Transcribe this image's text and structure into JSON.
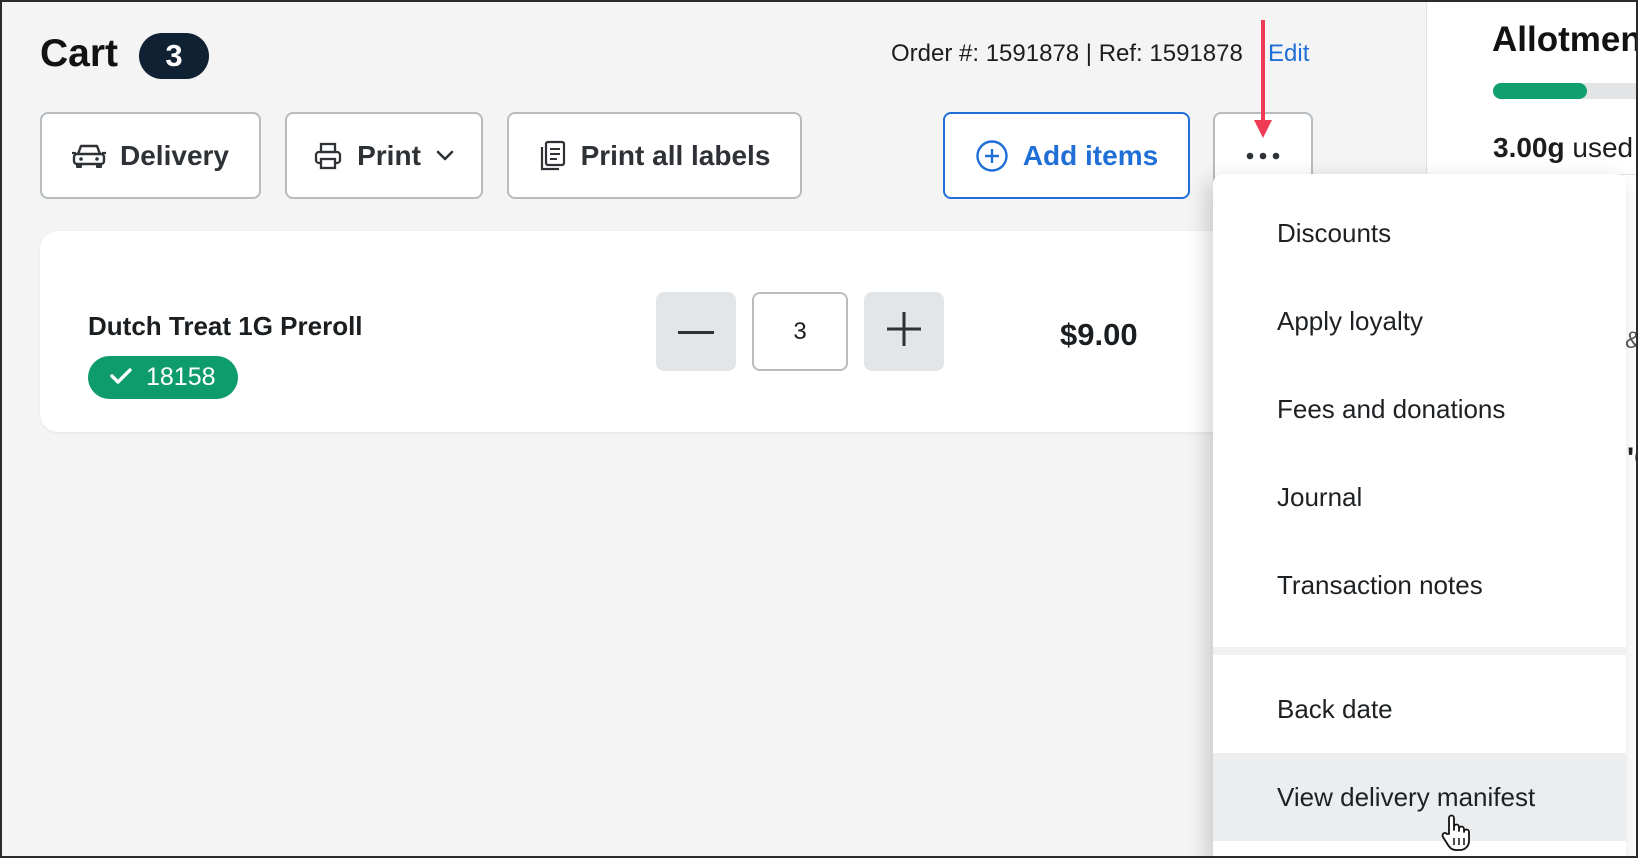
{
  "cart": {
    "title": "Cart",
    "count": "3",
    "order_info": "Order #: 1591878 | Ref: 1591878",
    "edit_label": "Edit"
  },
  "toolbar": {
    "delivery_label": "Delivery",
    "print_label": "Print",
    "print_all_labels": "Print all labels",
    "add_items_label": "Add items"
  },
  "item": {
    "name": "Dutch Treat 1G Preroll",
    "badge": "18158",
    "quantity": "3",
    "price": "$9.00"
  },
  "menu": {
    "items": [
      "Discounts",
      "Apply loyalty",
      "Fees and donations",
      "Journal",
      "Transaction notes",
      "Back date",
      "View delivery manifest"
    ],
    "hovered_item": "View delivery manifest"
  },
  "side": {
    "title": "Allotmen",
    "used_amount": "3.00g",
    "used_label": "used",
    "progress_fraction": 0.55,
    "fragment_amp": "&",
    "fragment_text": "'C"
  },
  "colors": {
    "accent_blue": "#1f6fd6",
    "badge_green": "#0f9c6c",
    "count_badge_bg": "#0f2133",
    "annotation_red": "#ee3a55"
  },
  "icons": [
    "car-icon",
    "printer-icon",
    "chevron-down-icon",
    "document-icon",
    "plus-circle-icon",
    "more-icon",
    "check-icon",
    "minus-icon",
    "plus-icon",
    "hand-cursor-icon"
  ]
}
